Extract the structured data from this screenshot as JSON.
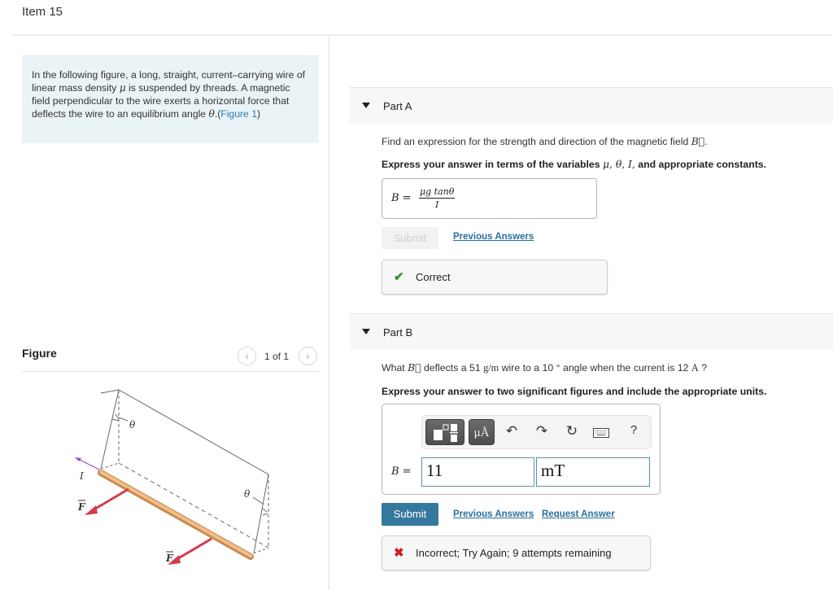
{
  "header": {
    "item_title": "Item 15"
  },
  "intro": {
    "text_before_mu": "In the following figure, a long, straight, current–carrying wire of linear mass density ",
    "mu_symbol": "μ",
    "text_after_mu": " is suspended by threads. A magnetic field perpendicular to the wire exerts a horizontal force that deflects the wire to an equilibrium angle ",
    "theta_symbol": "θ",
    "period": ".",
    "figure_link_open": "(",
    "figure_link": "Figure 1",
    "figure_link_close": ")"
  },
  "figure_panel": {
    "label": "Figure",
    "pager_text": "1 of 1",
    "prev_glyph": "‹",
    "next_glyph": "›",
    "labels": {
      "theta": "θ",
      "current": "I",
      "force": "F"
    },
    "colors": {
      "wire": "#e6a96a",
      "force_arrow": "#d63a4f",
      "current_arrow": "#8a4fbf"
    }
  },
  "partA": {
    "caret": "collapse-caret",
    "title": "Part A",
    "prompt_text": "Find an expression for the strength and direction of the magnetic field ",
    "prompt_symbol": "B⃗",
    "prompt_end": ".",
    "instruction_prefix": "Express your answer in terms of the variables ",
    "instruction_vars": "μ, θ, I,",
    "instruction_suffix": " and appropriate constants.",
    "answer_lhs": "B =",
    "answer_numerator": "μg tanθ",
    "answer_denominator": "I",
    "submit_label": "Submit",
    "previous_answers_label": "Previous Answers",
    "feedback_icon": "✔",
    "feedback_text": "Correct",
    "feedback_color": "#3a8a3a"
  },
  "partB": {
    "title": "Part B",
    "prompt_what": "What ",
    "prompt_symbol": "B⃗",
    "prompt_mid1": " deflects a 51 ",
    "prompt_unit1": "g/m",
    "prompt_mid2": " wire to a 10 ° angle when the current is 12 ",
    "prompt_unit2": "A",
    "prompt_end": " ?",
    "instruction": "Express your answer to two significant figures and include the appropriate units.",
    "toolbar": {
      "templates_icon": "templates-icon",
      "units_label": "μÅ",
      "undo_glyph": "↶",
      "redo_glyph": "↷",
      "reset_glyph": "↻",
      "help_glyph": "?"
    },
    "answer_lhs": "B =",
    "value": "11",
    "units": "mT",
    "submit_label": "Submit",
    "previous_answers_label": "Previous Answers",
    "request_answer_label": "Request Answer",
    "feedback_icon": "✖",
    "feedback_text": "Incorrect; Try Again; 9 attempts remaining",
    "feedback_color": "#cc2222",
    "submit_color": "#34789d"
  }
}
